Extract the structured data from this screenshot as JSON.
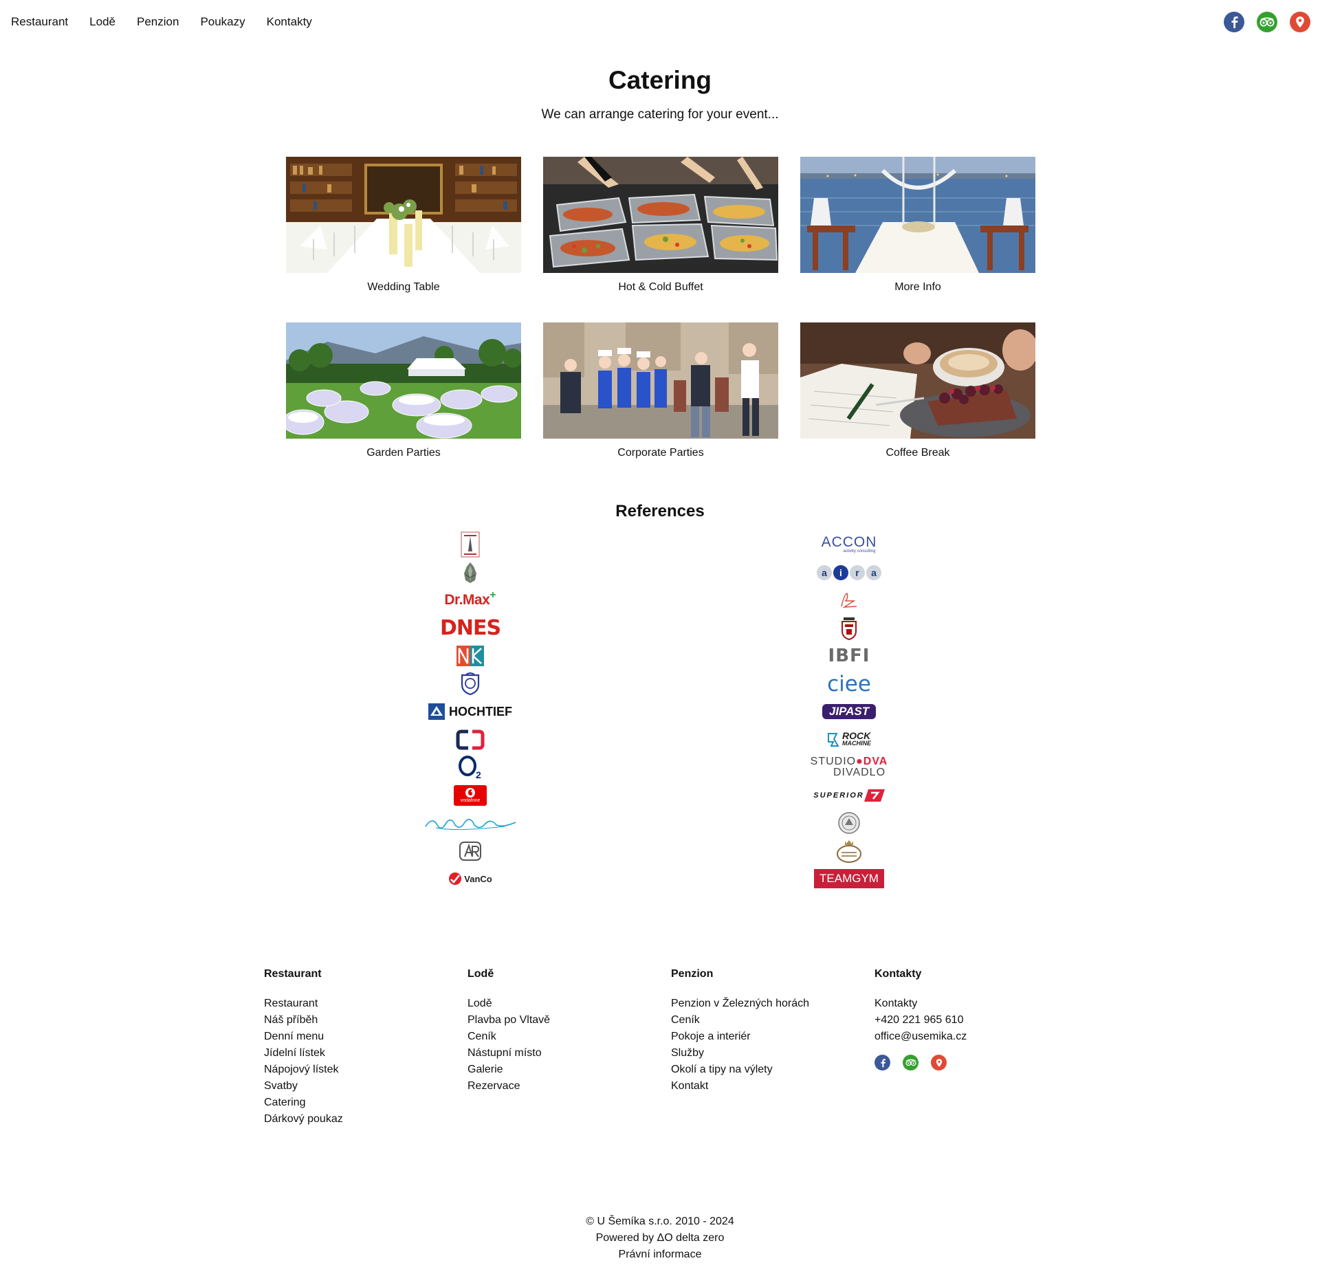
{
  "nav": {
    "items": [
      "Restaurant",
      "Lodě",
      "Penzion",
      "Poukazy",
      "Kontakty"
    ],
    "social": [
      "facebook-icon",
      "tripadvisor-icon",
      "map-pin-icon"
    ]
  },
  "colors": {
    "facebook": "#3b5998",
    "tripadvisor": "#34a02f",
    "map": "#e04a35",
    "dnes_red": "#d6231e",
    "vodafone_red": "#e60000",
    "teamgym_red": "#c8203a"
  },
  "page": {
    "title": "Catering",
    "subtitle": "We can arrange catering for your event..."
  },
  "cards": [
    {
      "caption": "Wedding Table"
    },
    {
      "caption": "Hot & Cold Buffet"
    },
    {
      "caption": "More Info"
    },
    {
      "caption": "Garden Parties"
    },
    {
      "caption": "Corporate Parties"
    },
    {
      "caption": "Coffee Break"
    }
  ],
  "references": {
    "title": "References",
    "left": {
      "drmax": "Dr.Max",
      "dnes": "DNES",
      "hochtief": "HOCHTIEF",
      "vodafone": "vodafone",
      "vanco": "VanCo"
    },
    "right": {
      "accon": "ACCON",
      "accon_sub": "activity consulting",
      "aira": [
        "a",
        "i",
        "r",
        "a"
      ],
      "ibfi": "IBFI",
      "ciee": "ciee",
      "jipast": "JIPAST",
      "rock": "ROCK",
      "rock_sub": "MACHINE",
      "studio": "STUDIO",
      "dva": "DVA",
      "divadlo": "DIVADLO",
      "superior": "SUPERIOR",
      "teamgym": "TEAMGYM"
    }
  },
  "footer": {
    "columns": [
      {
        "heading": "Restaurant",
        "items": [
          "Restaurant",
          "Náš příběh",
          "Denní menu",
          "Jídelní lístek",
          "Nápojový lístek",
          "Svatby",
          "Catering",
          "Dárkový poukaz"
        ]
      },
      {
        "heading": "Lodě",
        "items": [
          "Lodě",
          "Plavba po Vltavě",
          "Ceník",
          "Nástupní místo",
          "Galerie",
          "Rezervace"
        ]
      },
      {
        "heading": "Penzion",
        "items": [
          "Penzion v Železných horách",
          "Ceník",
          "Pokoje a interiér",
          "Služby",
          "Okolí a tipy na výlety",
          "Kontakt"
        ]
      },
      {
        "heading": "Kontakty",
        "items": [
          "Kontakty",
          "+420 221 965 610",
          "office@usemika.cz"
        ]
      }
    ]
  },
  "bottom": {
    "copyright": "© U Šemíka s.r.o. 2010 - 2024",
    "powered": "Powered by ΔO delta zero",
    "legal": "Právní informace"
  }
}
